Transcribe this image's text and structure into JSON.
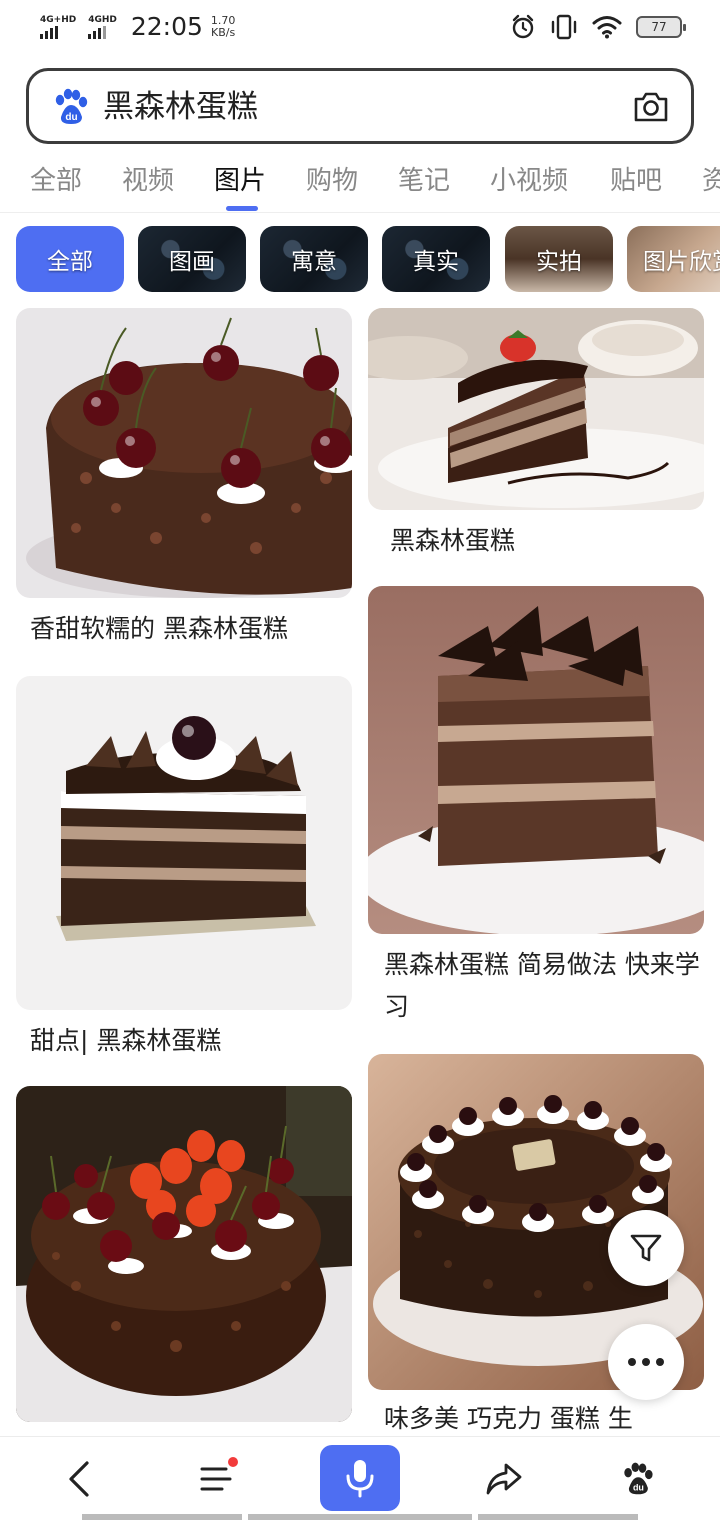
{
  "status_bar": {
    "signal1": "4G+HD",
    "signal2": "4GHD",
    "time": "22:05",
    "speed_value": "1.70",
    "speed_unit": "KB/s",
    "battery": "77"
  },
  "search": {
    "query": "黑森林蛋糕",
    "logo_icon": "baidu-paw-icon",
    "camera_icon": "camera-icon"
  },
  "tabs": [
    {
      "label": "全部"
    },
    {
      "label": "视频"
    },
    {
      "label": "图片"
    },
    {
      "label": "购物"
    },
    {
      "label": "笔记"
    },
    {
      "label": "小视频"
    },
    {
      "label": "贴吧"
    },
    {
      "label": "资"
    }
  ],
  "active_tab": "图片",
  "chips": [
    {
      "label": "全部"
    },
    {
      "label": "图画"
    },
    {
      "label": "寓意"
    },
    {
      "label": "真实"
    },
    {
      "label": "实拍"
    },
    {
      "label": "图片欣赏"
    }
  ],
  "results": [
    {
      "caption": "香甜软糯的 黑森林蛋糕"
    },
    {
      "caption": "黑森林蛋糕"
    },
    {
      "caption": "甜点| 黑森林蛋糕"
    },
    {
      "caption": "黑森林蛋糕 简易做法 快来学习"
    },
    {
      "caption": ""
    },
    {
      "caption": "味多美 巧克力 蛋糕 生"
    }
  ],
  "colors": {
    "accent": "#4e6ef2",
    "notification": "#f23b3b"
  },
  "bottom_nav": {
    "back_icon": "back-arrow-icon",
    "menu_icon": "menu-icon",
    "mic_icon": "microphone-icon",
    "share_icon": "share-icon",
    "home_icon": "baidu-paw-icon"
  }
}
